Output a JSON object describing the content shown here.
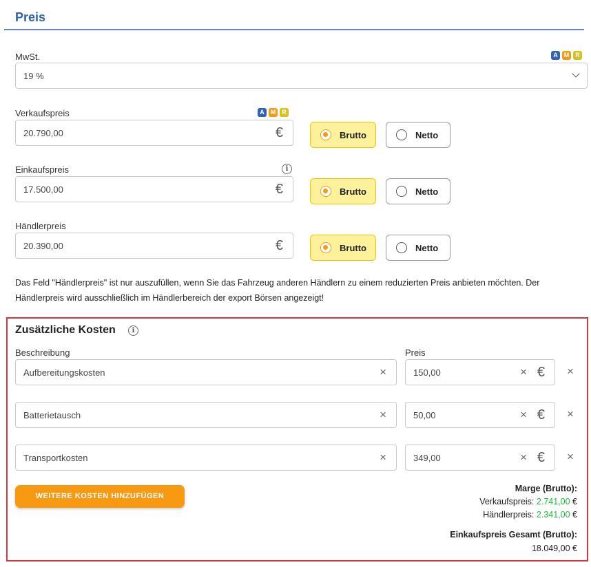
{
  "section": {
    "title": "Preis"
  },
  "badge_letters": {
    "a": "A",
    "m": "M",
    "r": "R"
  },
  "mwst": {
    "label": "MwSt.",
    "value": "19 %"
  },
  "verkaufspreis": {
    "label": "Verkaufspreis",
    "value": "20.790,00",
    "currency": "€"
  },
  "einkaufspreis": {
    "label": "Einkaufspreis",
    "value": "17.500,00",
    "currency": "€"
  },
  "haendlerpreis": {
    "label": "Händlerpreis",
    "value": "20.390,00",
    "currency": "€"
  },
  "toggle": {
    "brutto": "Brutto",
    "netto": "Netto"
  },
  "note": "Das Feld \"Händlerpreis\" ist nur auszufüllen, wenn Sie das Fahrzeug anderen Händlern zu einem reduzierten Preis anbieten möchten. Der Händlerpreis wird ausschließlich im Händlerbereich der export Börsen angezeigt!",
  "kosten": {
    "title": "Zusätzliche Kosten",
    "col_beschreibung": "Beschreibung",
    "col_preis": "Preis",
    "rows": [
      {
        "beschreibung": "Aufbereitungskosten",
        "preis": "150,00"
      },
      {
        "beschreibung": "Batterietausch",
        "preis": "50,00"
      },
      {
        "beschreibung": "Transportkosten",
        "preis": "349,00"
      }
    ],
    "add_button": "WEITERE KOSTEN HINZUFÜGEN"
  },
  "marge": {
    "title": "Marge (Brutto):",
    "verkauf_label": "Verkaufspreis:",
    "verkauf_value": "2.741,00",
    "haendler_label": "Händlerpreis:",
    "haendler_value": "2.341,00",
    "einkauf_title": "Einkaufspreis Gesamt (Brutto):",
    "einkauf_value": "18.049,00",
    "currency": "€"
  },
  "colors": {
    "accent_blue": "#2f63a8",
    "orange": "#f79a12",
    "highlight": "#fdf29b",
    "green": "#1db93b",
    "border_red": "#d9363e"
  },
  "icons": {
    "info": "i",
    "clear": "×",
    "chevron": "chevron-down"
  }
}
